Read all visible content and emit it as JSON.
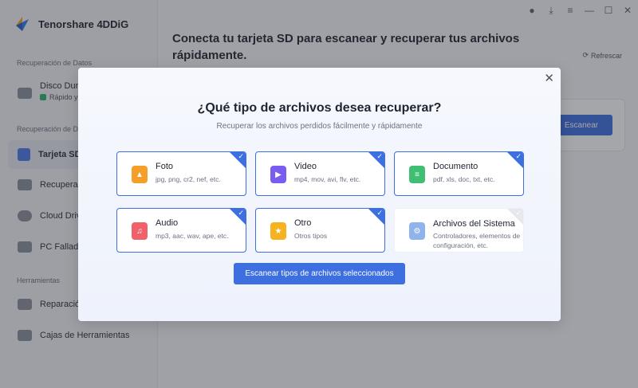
{
  "app": {
    "name": "Tenorshare 4DDiG"
  },
  "sidebar": {
    "sections": [
      "Recuperación de Datos",
      "Recuperación de Da",
      "Herramientas"
    ],
    "items": [
      {
        "label": "Disco Duro",
        "sub": "Rápido y"
      },
      {
        "label": "Tarjeta SD"
      },
      {
        "label": "Recuperac"
      },
      {
        "label": "Cloud Driv"
      },
      {
        "label": "PC Fallado"
      },
      {
        "label": "Reparació"
      },
      {
        "label": "Cajas de Herramientas"
      }
    ]
  },
  "main": {
    "title": "Conecta tu tarjeta SD para escanear y recuperar tus archivos rápidamente.",
    "refresh": "Refrescar",
    "scan_button": "Escanear"
  },
  "modal": {
    "title": "¿Qué tipo de archivos desea recuperar?",
    "subtitle": "Recuperar los archivos perdidos fácilmente y rápidamente",
    "types": [
      {
        "title": "Foto",
        "desc": "jpg, png, cr2, nef, etc.",
        "selected": true,
        "color": "#f59e2a"
      },
      {
        "title": "Video",
        "desc": "mp4, mov, avi, flv, etc.",
        "selected": true,
        "color": "#7b5cf0"
      },
      {
        "title": "Documento",
        "desc": "pdf, xls, doc, txt, etc.",
        "selected": true,
        "color": "#3fbf73"
      },
      {
        "title": "Audio",
        "desc": "mp3, aac, wav, ape, etc.",
        "selected": true,
        "color": "#f0616b"
      },
      {
        "title": "Otro",
        "desc": "Otros tipos",
        "selected": true,
        "color": "#f5b322"
      },
      {
        "title": "Archivos del Sistema",
        "desc": "Controladores, elementos de configuración, etc.",
        "selected": false,
        "color": "#8fb3ea"
      }
    ],
    "scan_button": "Escanear tipos de archivos seleccionados"
  },
  "colors": {
    "accent": "#3d6fe0"
  }
}
